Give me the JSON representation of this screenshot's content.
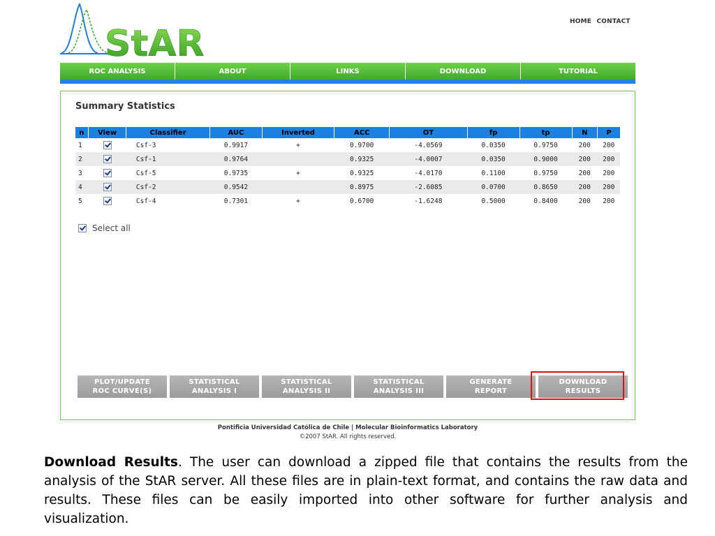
{
  "brand": {
    "logo_text": "StAR"
  },
  "top_links": [
    "HOME",
    "CONTACT"
  ],
  "nav": [
    "ROC ANALYSIS",
    "ABOUT",
    "LINKS",
    "DOWNLOAD",
    "TUTORIAL"
  ],
  "panel": {
    "title": "Summary Statistics",
    "columns": [
      "n",
      "View",
      "Classifier",
      "AUC",
      "Inverted",
      "ACC",
      "OT",
      "fp",
      "tp",
      "N",
      "P"
    ],
    "rows": [
      {
        "n": "1",
        "view": true,
        "classifier": "Csf-3",
        "auc": "0.9917",
        "inverted": "+",
        "acc": "0.9700",
        "ot": "-4.0569",
        "fp": "0.0350",
        "tp": "0.9750",
        "N": "200",
        "P": "200"
      },
      {
        "n": "2",
        "view": true,
        "classifier": "Csf-1",
        "auc": "0.9764",
        "inverted": "",
        "acc": "0.9325",
        "ot": "-4.0007",
        "fp": "0.0350",
        "tp": "0.9000",
        "N": "200",
        "P": "200"
      },
      {
        "n": "3",
        "view": true,
        "classifier": "Csf-5",
        "auc": "0.9735",
        "inverted": "+",
        "acc": "0.9325",
        "ot": "-4.0170",
        "fp": "0.1100",
        "tp": "0.9750",
        "N": "200",
        "P": "200"
      },
      {
        "n": "4",
        "view": true,
        "classifier": "Csf-2",
        "auc": "0.9542",
        "inverted": "",
        "acc": "0.8975",
        "ot": "-2.6085",
        "fp": "0.0700",
        "tp": "0.8650",
        "N": "200",
        "P": "200"
      },
      {
        "n": "5",
        "view": true,
        "classifier": "Csf-4",
        "auc": "0.7301",
        "inverted": "+",
        "acc": "0.6700",
        "ot": "-1.6248",
        "fp": "0.5000",
        "tp": "0.8400",
        "N": "200",
        "P": "200"
      }
    ],
    "select_all_label": "Select all",
    "select_all_checked": true,
    "actions": [
      {
        "line1": "PLOT/UPDATE",
        "line2": "ROC CURVE(S)"
      },
      {
        "line1": "STATISTICAL",
        "line2": "ANALYSIS I"
      },
      {
        "line1": "STATISTICAL",
        "line2": "ANALYSIS II"
      },
      {
        "line1": "STATISTICAL",
        "line2": "ANALYSIS III"
      },
      {
        "line1": "GENERATE",
        "line2": "REPORT"
      },
      {
        "line1": "DOWNLOAD",
        "line2": "RESULTS"
      }
    ],
    "highlighted_action": "DOWNLOAD RESULTS"
  },
  "footer": {
    "line1": "Pontificia Universidad Católica de Chile  |  Molecular Bioinformatics Laboratory",
    "line2": "©2007 StAR. All rights reserved."
  },
  "caption": {
    "lead": "Download Results",
    "text": ". The user can download a zipped file that contains the results from the analysis of the StAR server. All these files are in plain-text format, and contains the raw data and results. These files can be easily imported into other software for further analysis and visualization."
  },
  "colors": {
    "nav_green": "#4cb832",
    "nav_blue_bar": "#1f86e0",
    "table_header": "#1d7fe0",
    "panel_border": "#6fcc5a",
    "action_gray": "#a8a8a8",
    "highlight_red": "#e01010"
  }
}
